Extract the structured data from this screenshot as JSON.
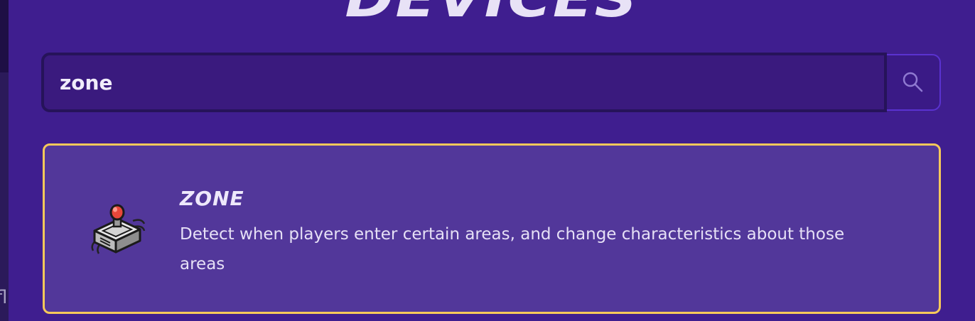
{
  "page": {
    "title": "DEVICES",
    "side_text": "fl"
  },
  "search": {
    "value": "zone",
    "icon": "search-icon"
  },
  "results": [
    {
      "title": "ZONE",
      "description": "Detect when players enter certain areas, and change characteristics about those areas",
      "icon": "zone-device-icon"
    }
  ],
  "colors": {
    "background": "#3f1e8f",
    "card": "#52379a",
    "card_border": "#f6c85a",
    "search_border": "#5a32d0"
  }
}
